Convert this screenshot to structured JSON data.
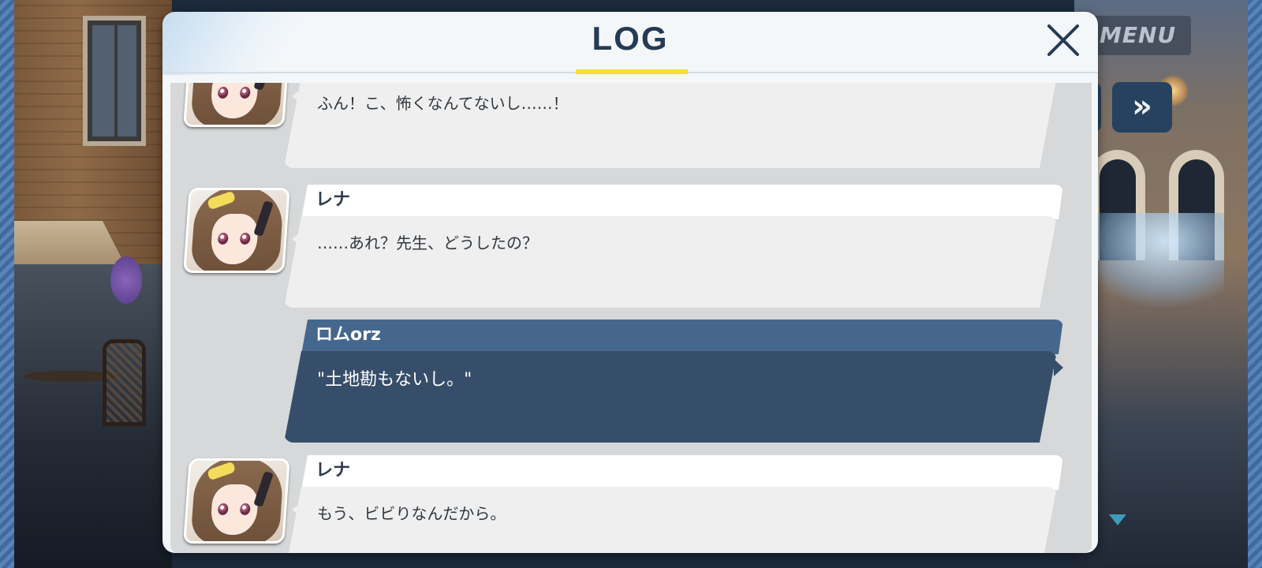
{
  "hud": {
    "menu_label": "MENU",
    "fast_forward_glyph": "»"
  },
  "log": {
    "title": "LOG",
    "entries": [
      {
        "speaker": "",
        "text": "ふん！こ、怖くなんてないし……！",
        "is_player": false
      },
      {
        "speaker": "レナ",
        "text": "……あれ？先生、どうしたの？",
        "is_player": false
      },
      {
        "speaker": "ロムorz",
        "text": "\"土地勘もないし。\"",
        "is_player": true
      },
      {
        "speaker": "レナ",
        "text": "もう、ビビりなんだから。",
        "is_player": false
      }
    ]
  },
  "colors": {
    "title_text": "#243a55",
    "title_underline": "#f6de34",
    "player_name_bar": "#46678d",
    "player_message": "#374e6b",
    "npc_message": "#efefef"
  },
  "icons": [
    "close-icon",
    "fast-forward-icon",
    "scroll-down-icon",
    "menu-button"
  ]
}
